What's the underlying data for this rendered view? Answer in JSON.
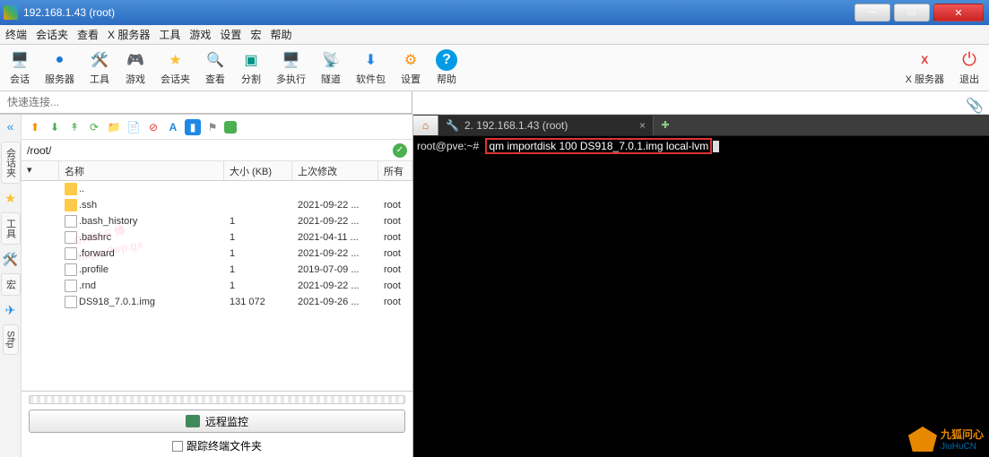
{
  "window": {
    "title": "192.168.1.43 (root)"
  },
  "menus": [
    "终端",
    "会话夹",
    "查看",
    "X 服务器",
    "工具",
    "游戏",
    "设置",
    "宏",
    "帮助"
  ],
  "toolbar": [
    {
      "label": "会话",
      "icon": "🖥️",
      "color": "#2e7d32"
    },
    {
      "label": "服务器",
      "icon": "🔵",
      "color": "#1976d2"
    },
    {
      "label": "工具",
      "icon": "🛠️",
      "color": "#c2185b"
    },
    {
      "label": "游戏",
      "icon": "🎮",
      "color": "#607d8b"
    },
    {
      "label": "会话夹",
      "icon": "★",
      "color": "#fbc02d"
    },
    {
      "label": "查看",
      "icon": "🔍",
      "color": "#3f51b5"
    },
    {
      "label": "分割",
      "icon": "▣",
      "color": "#009688"
    },
    {
      "label": "多执行",
      "icon": "🖥️",
      "color": "#455a64"
    },
    {
      "label": "隧道",
      "icon": "📡",
      "color": "#ef6c00"
    },
    {
      "label": "软件包",
      "icon": "⬇",
      "color": "#1e88e5"
    },
    {
      "label": "设置",
      "icon": "⚙",
      "color": "#fb8c00"
    },
    {
      "label": "帮助",
      "icon": "?",
      "color": "#039be5"
    }
  ],
  "toolbar_right": [
    {
      "label": "X 服务器",
      "icon": "X",
      "color": "#000"
    },
    {
      "label": "退出",
      "icon": "⏻",
      "color": "#e53935"
    }
  ],
  "quick_placeholder": "快速连接...",
  "rail": {
    "sessions": "会话夹",
    "tools": "工具",
    "macros": "宏",
    "sftp": "Sftp"
  },
  "ftp_path": "/root/",
  "file_columns": {
    "name": "名称",
    "size": "大小 (KB)",
    "date": "上次修改",
    "owner": "所有"
  },
  "files": [
    {
      "name": "..",
      "type": "folder",
      "size": "",
      "date": "",
      "owner": ""
    },
    {
      "name": ".ssh",
      "type": "folder",
      "size": "",
      "date": "2021-09-22 ...",
      "owner": "root"
    },
    {
      "name": ".bash_history",
      "type": "file",
      "size": "1",
      "date": "2021-09-22 ...",
      "owner": "root"
    },
    {
      "name": ".bashrc",
      "type": "file",
      "size": "1",
      "date": "2021-04-11 ...",
      "owner": "root"
    },
    {
      "name": ".forward",
      "type": "file",
      "size": "1",
      "date": "2021-09-22 ...",
      "owner": "root"
    },
    {
      "name": ".profile",
      "type": "file",
      "size": "1",
      "date": "2019-07-09 ...",
      "owner": "root"
    },
    {
      "name": ".rnd",
      "type": "file",
      "size": "1",
      "date": "2021-09-22 ...",
      "owner": "root"
    },
    {
      "name": "DS918_7.0.1.img",
      "type": "file",
      "size": "131 072",
      "date": "2021-09-26 ...",
      "owner": "root"
    }
  ],
  "remote_monitor": "远程监控",
  "track_folders": "跟踪终端文件夹",
  "tab": {
    "home": "⌂",
    "active_label": "2. 192.168.1.43 (root)"
  },
  "terminal": {
    "prompt": "root@pve:~#",
    "command": "qm importdisk 100 DS918_7.0.1.img local-lvm"
  },
  "watermark": {
    "l1": "GXNAS 博",
    "l2": "https://wp.gx"
  },
  "brand": {
    "cn": "九狐问心",
    "en": "JiuHuCN"
  }
}
